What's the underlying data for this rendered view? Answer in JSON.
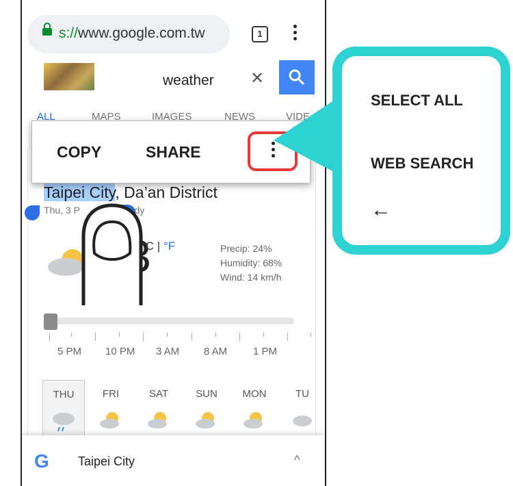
{
  "browser": {
    "url_scheme": "s://",
    "url_host": "www.google.com.tw",
    "tab_count": "1"
  },
  "search": {
    "query": "weather",
    "clear_symbol": "✕"
  },
  "categories": [
    "ALL",
    "MAPS",
    "IMAGES",
    "NEWS",
    "VIDE"
  ],
  "weather": {
    "location_selected": "Taipei City",
    "location_rest": ", Da’an District",
    "subline_start": "Thu, 3 P",
    "subline_end": "oudy",
    "temp_fragment": "3",
    "unit_c": "°C | ",
    "unit_f": "°F",
    "precip": "Precip: 24%",
    "humidity": "Humidity: 68%",
    "wind": "Wind: 14 km/h",
    "times": [
      "5 PM",
      "10 PM",
      "3 AM",
      "8 AM",
      "1 PM"
    ],
    "days": [
      "THU",
      "FRI",
      "SAT",
      "SUN",
      "MON",
      "TU"
    ]
  },
  "bottom_bar": {
    "logo": "G",
    "title": "Taipei City",
    "chevron": "^"
  },
  "context_menu": {
    "copy": "COPY",
    "share": "SHARE"
  },
  "overflow_popup": {
    "select_all": "SELECT ALL",
    "web_search": "WEB SEARCH",
    "back_arrow": "←"
  },
  "colors": {
    "accent": "#2ed2d2",
    "highlight": "#e53935",
    "selection": "#a8d0ff",
    "google_blue": "#4285f4"
  },
  "icons": [
    "lock-icon",
    "tab-switcher-icon",
    "overflow-menu-icon",
    "search-icon",
    "close-icon",
    "partly-cloudy-icon",
    "google-logo-icon",
    "chevron-up-icon",
    "back-arrow-icon",
    "finger-gesture-icon"
  ]
}
